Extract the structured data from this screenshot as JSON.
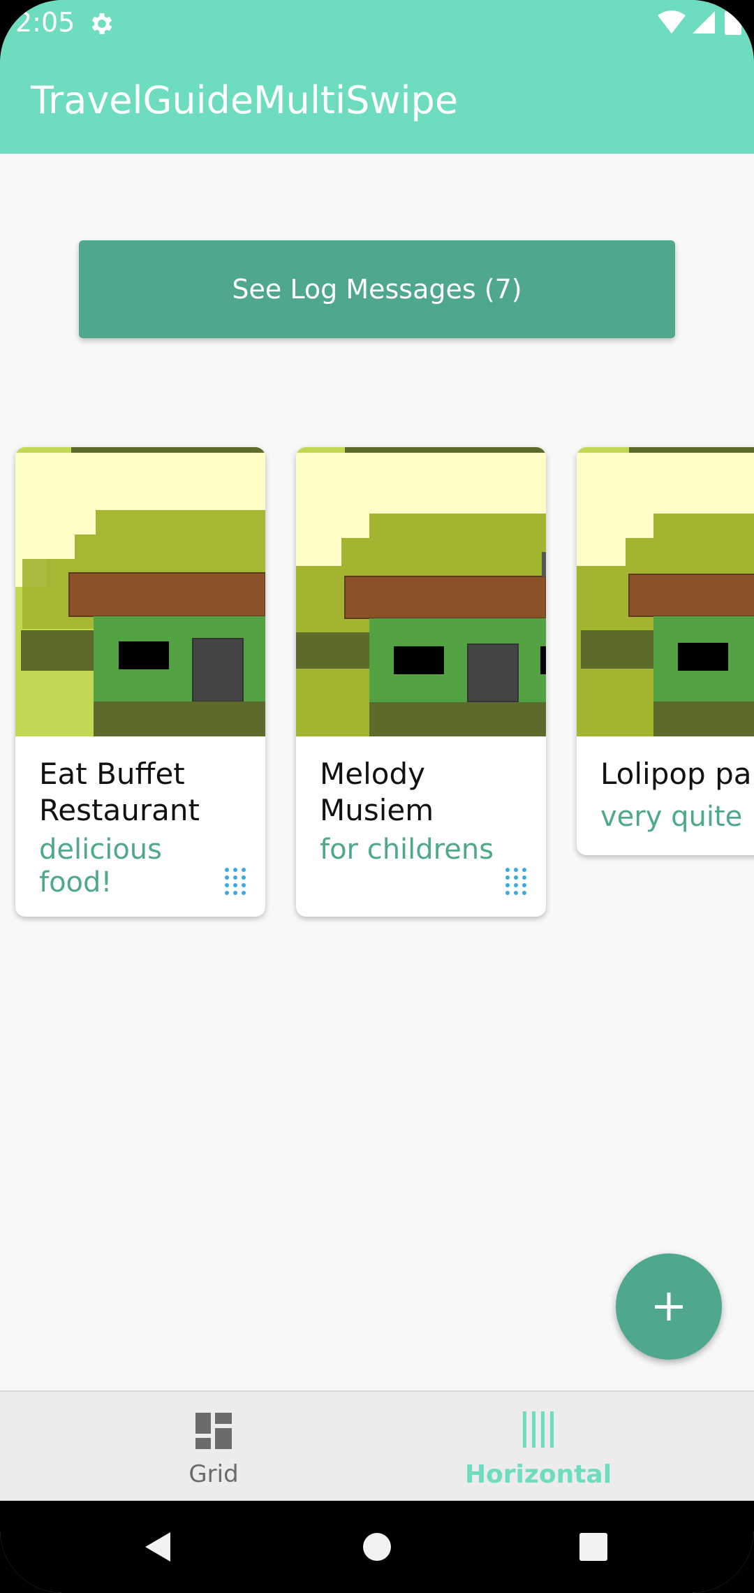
{
  "status_bar": {
    "time": "2:05",
    "settings_icon": "gear-icon",
    "right_icons": [
      "wifi-icon",
      "signal-icon",
      "battery-icon"
    ]
  },
  "app_bar": {
    "title": "TravelGuideMultiSwipe"
  },
  "log_button": {
    "label": "See Log Messages (7)"
  },
  "cards": [
    {
      "title": "Eat Buffet Restaurant",
      "subtitle": "delicious food!"
    },
    {
      "title": "Melody Musiem",
      "subtitle": "for childrens"
    },
    {
      "title": "Lolipop par",
      "subtitle": "very quite"
    }
  ],
  "fab": {
    "icon": "plus-icon"
  },
  "bottom_nav": {
    "items": [
      {
        "label": "Grid",
        "icon": "grid-dashboard-icon",
        "selected": false
      },
      {
        "label": "Horizontal",
        "icon": "vertical-bars-icon",
        "selected": true
      }
    ]
  },
  "system_nav": {
    "back": "back-icon",
    "home": "home-icon",
    "recents": "recents-icon"
  },
  "colors": {
    "accent": "#6edcbf",
    "primary_dark": "#4fa88e",
    "nav_selected": "#6edcbf",
    "nav_unselected": "#6b6b6b"
  }
}
